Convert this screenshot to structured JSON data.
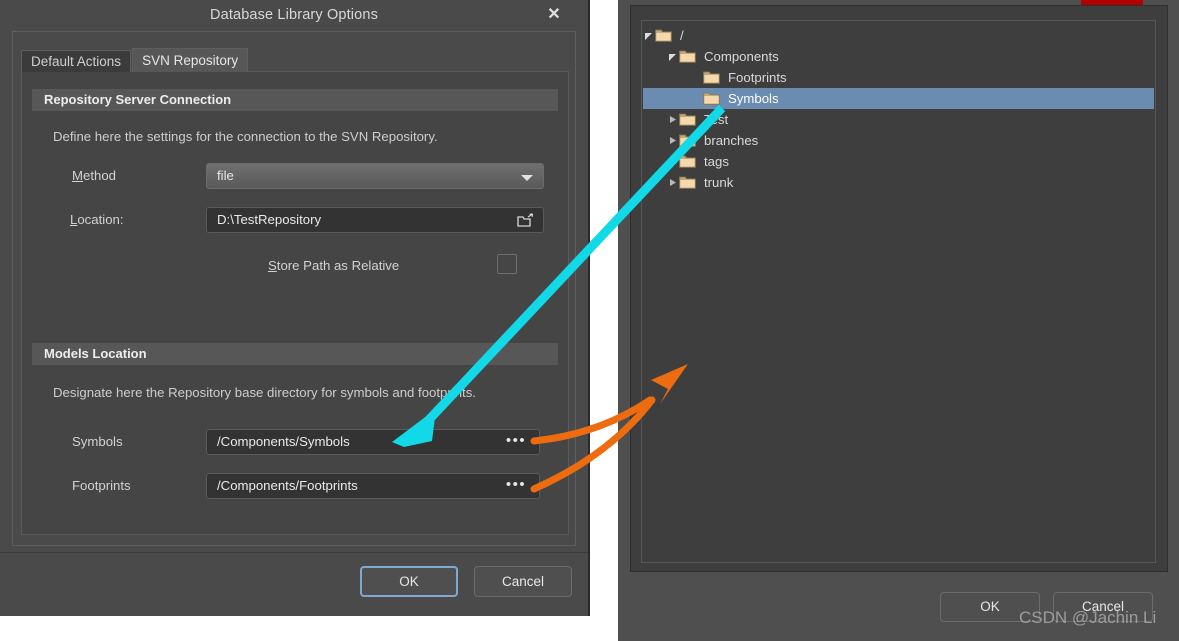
{
  "dialog": {
    "title": "Database Library Options",
    "close_icon": "close-x-icon",
    "tabs": [
      {
        "label": "Default Actions",
        "active": false
      },
      {
        "label": "SVN Repository",
        "active": true
      }
    ],
    "groups": {
      "connection": {
        "header": "Repository Server Connection",
        "description": "Define here the settings for the connection to the SVN Repository.",
        "method": {
          "label": "Method",
          "accelerator": "M",
          "value": "file",
          "arrow_icon": "chevron-down-icon"
        },
        "location": {
          "label": "Location:",
          "accelerator": "L",
          "value": "D:\\TestRepository",
          "browse_icon": "open-folder-icon"
        },
        "store_relative": {
          "label": "Store Path as Relative",
          "accelerator": "S",
          "checked": false
        }
      },
      "models": {
        "header": "Models Location",
        "description": "Designate here the Repository base directory for symbols and footprints.",
        "symbols": {
          "label": "Symbols",
          "value": "/Components/Symbols",
          "browse_label": "•••"
        },
        "footprints": {
          "label": "Footprints",
          "value": "/Components/Footprints",
          "browse_label": "•••"
        }
      }
    },
    "buttons": {
      "ok": "OK",
      "cancel": "Cancel"
    }
  },
  "browser": {
    "close_button": "close-window-button",
    "tree": [
      {
        "label": "/",
        "depth": 0,
        "state": "expanded",
        "selected": false
      },
      {
        "label": "Components",
        "depth": 1,
        "state": "expanded",
        "selected": false
      },
      {
        "label": "Footprints",
        "depth": 2,
        "state": "leaf",
        "selected": false
      },
      {
        "label": "Symbols",
        "depth": 2,
        "state": "leaf",
        "selected": true
      },
      {
        "label": "Test",
        "depth": 1,
        "state": "collapsed",
        "selected": false
      },
      {
        "label": "branches",
        "depth": 1,
        "state": "collapsed",
        "selected": false
      },
      {
        "label": "tags",
        "depth": 1,
        "state": "collapsed",
        "selected": false
      },
      {
        "label": "trunk",
        "depth": 1,
        "state": "collapsed",
        "selected": false
      }
    ],
    "buttons": {
      "ok": "OK",
      "cancel": "Cancel"
    }
  },
  "annotations": {
    "watermark": "CSDN @Jachin Li",
    "cyan_color": "#12d9e8",
    "orange_color": "#ed6c10"
  },
  "colors": {
    "dialog_bg": "#4a4a4a",
    "panel_bg": "#454545",
    "field_bg": "#333333",
    "group_header_bg": "#575757",
    "tree_selection": "#6a8cb0",
    "focus_border": "#7fa8d4",
    "folder_fill": "#f5d8ab",
    "close_red": "#b00000"
  }
}
